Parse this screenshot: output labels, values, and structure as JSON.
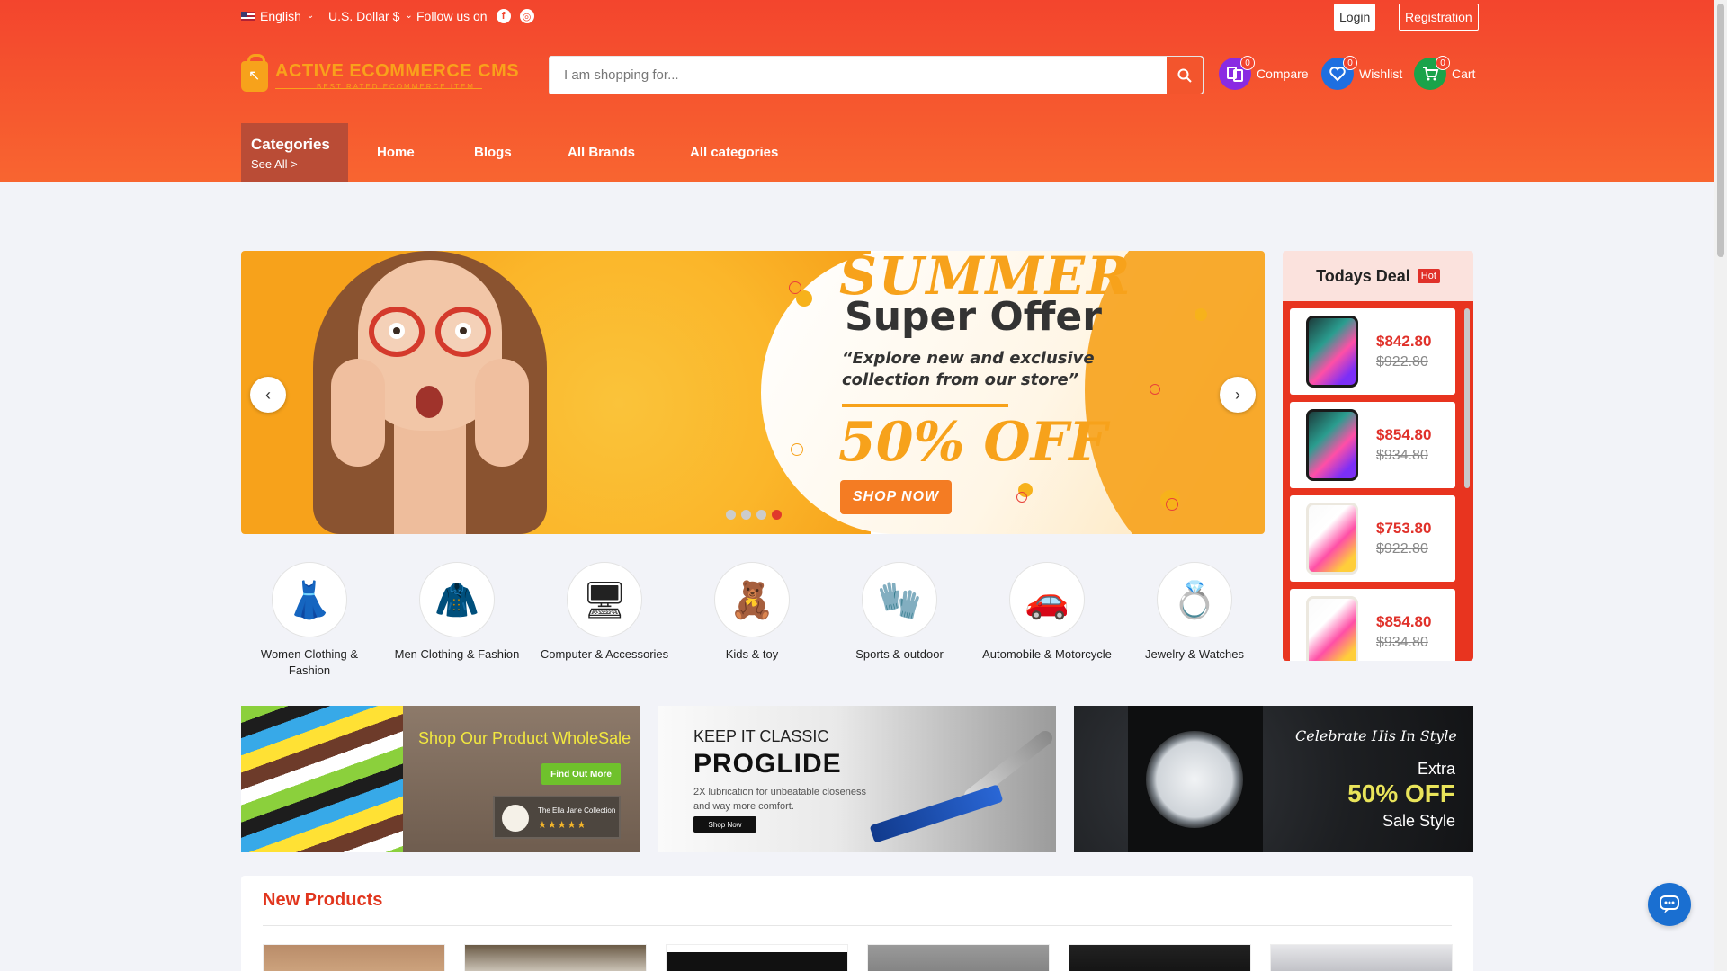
{
  "topbar": {
    "language": "English",
    "currency": "U.S. Dollar $",
    "follow_label": "Follow us on",
    "login": "Login",
    "registration": "Registration"
  },
  "logo": {
    "name": "ACTIVE ECOMMERCE CMS",
    "tagline": "BEST RATED ECOMMERCE ITEM"
  },
  "search": {
    "placeholder": "I am shopping for..."
  },
  "header_actions": [
    {
      "label": "Compare",
      "count": "0",
      "icon": "compare-icon",
      "color": "#8a2be2"
    },
    {
      "label": "Wishlist",
      "count": "0",
      "icon": "heart-icon",
      "color": "#1e6fe0"
    },
    {
      "label": "Cart",
      "count": "0",
      "icon": "cart-icon",
      "color": "#1aa34a"
    }
  ],
  "nav": {
    "categories_title": "Categories",
    "categories_see_all": "See All >",
    "links": [
      "Home",
      "Blogs",
      "All Brands",
      "All categories"
    ]
  },
  "slider": {
    "title": "SUMMER",
    "subtitle": "Super Offer",
    "quote_line1": "“Explore new and exclusive",
    "quote_line2": "collection from our store”",
    "discount": "50% OFF",
    "cta": "SHOP NOW",
    "slide_count": 4,
    "active_slide": 4
  },
  "todays_deal": {
    "title": "Todays Deal",
    "badge": "Hot",
    "items": [
      {
        "price": "$842.80",
        "old_price": "$922.80",
        "variant": "dark"
      },
      {
        "price": "$854.80",
        "old_price": "$934.80",
        "variant": "dark"
      },
      {
        "price": "$753.80",
        "old_price": "$922.80",
        "variant": "light"
      },
      {
        "price": "$854.80",
        "old_price": "$934.80",
        "variant": "light"
      }
    ]
  },
  "categories": [
    {
      "label": "Women Clothing & Fashion",
      "icon": "dress-icon",
      "glyph": "👗"
    },
    {
      "label": "Men Clothing & Fashion",
      "icon": "jacket-icon",
      "glyph": "🧥"
    },
    {
      "label": "Computer & Accessories",
      "icon": "pc-case-icon",
      "glyph": "🖥"
    },
    {
      "label": "Kids & toy",
      "icon": "toy-icon",
      "glyph": "🧸"
    },
    {
      "label": "Sports & outdoor",
      "icon": "glove-icon",
      "glyph": "🧤"
    },
    {
      "label": "Automobile & Motorcycle",
      "icon": "car-icon",
      "glyph": "🚗"
    },
    {
      "label": "Jewelry & Watches",
      "icon": "ring-icon",
      "glyph": "💍"
    }
  ],
  "banners": {
    "b1": {
      "title": "Shop Our Product WholeSale",
      "cta": "Find Out More",
      "badge": "The Ella Jane Collection",
      "stars": "★★★★★"
    },
    "b2": {
      "kicker": "KEEP IT CLASSIC",
      "title": "PROGLIDE",
      "desc": "2X lubrication for unbeatable closeness and way more comfort.",
      "cta": "Shop Now"
    },
    "b3": {
      "kicker": "Celebrate His In Style",
      "extra": "Extra",
      "discount": "50% OFF",
      "sale": "Sale Style"
    }
  },
  "new_products": {
    "title": "New Products"
  },
  "colors": {
    "brand": "#f3452d",
    "accent": "#f7a21b",
    "price": "#e0312a"
  }
}
